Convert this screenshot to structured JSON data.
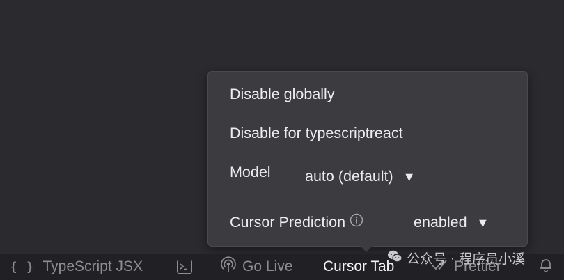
{
  "popup": {
    "disable_globally": "Disable globally",
    "disable_for_lang": "Disable for typescriptreact",
    "model_label": "Model",
    "model_value": "auto (default)",
    "prediction_label": "Cursor Prediction",
    "prediction_value": "enabled",
    "caret_glyph": "▼"
  },
  "status_bar": {
    "language_braces": "{ }",
    "language": "TypeScript JSX",
    "go_live": "Go Live",
    "cursor_tab": "Cursor Tab",
    "prettier": "Prettier"
  },
  "watermark": {
    "text": "公众号 · 程序员小溪"
  },
  "colors": {
    "background": "#2b2a2f",
    "popup_bg": "#3c3b40",
    "status_bar_bg": "#212024",
    "status_text": "#8e8d92",
    "active_text": "#f2f2f4"
  },
  "icons": {
    "braces": "braces-icon",
    "terminal": "terminal-icon",
    "go_live": "broadcast-icon",
    "prettier": "double-check-icon",
    "notifications": "bell-icon",
    "info": "info-icon",
    "watermark": "wechat-icon"
  }
}
